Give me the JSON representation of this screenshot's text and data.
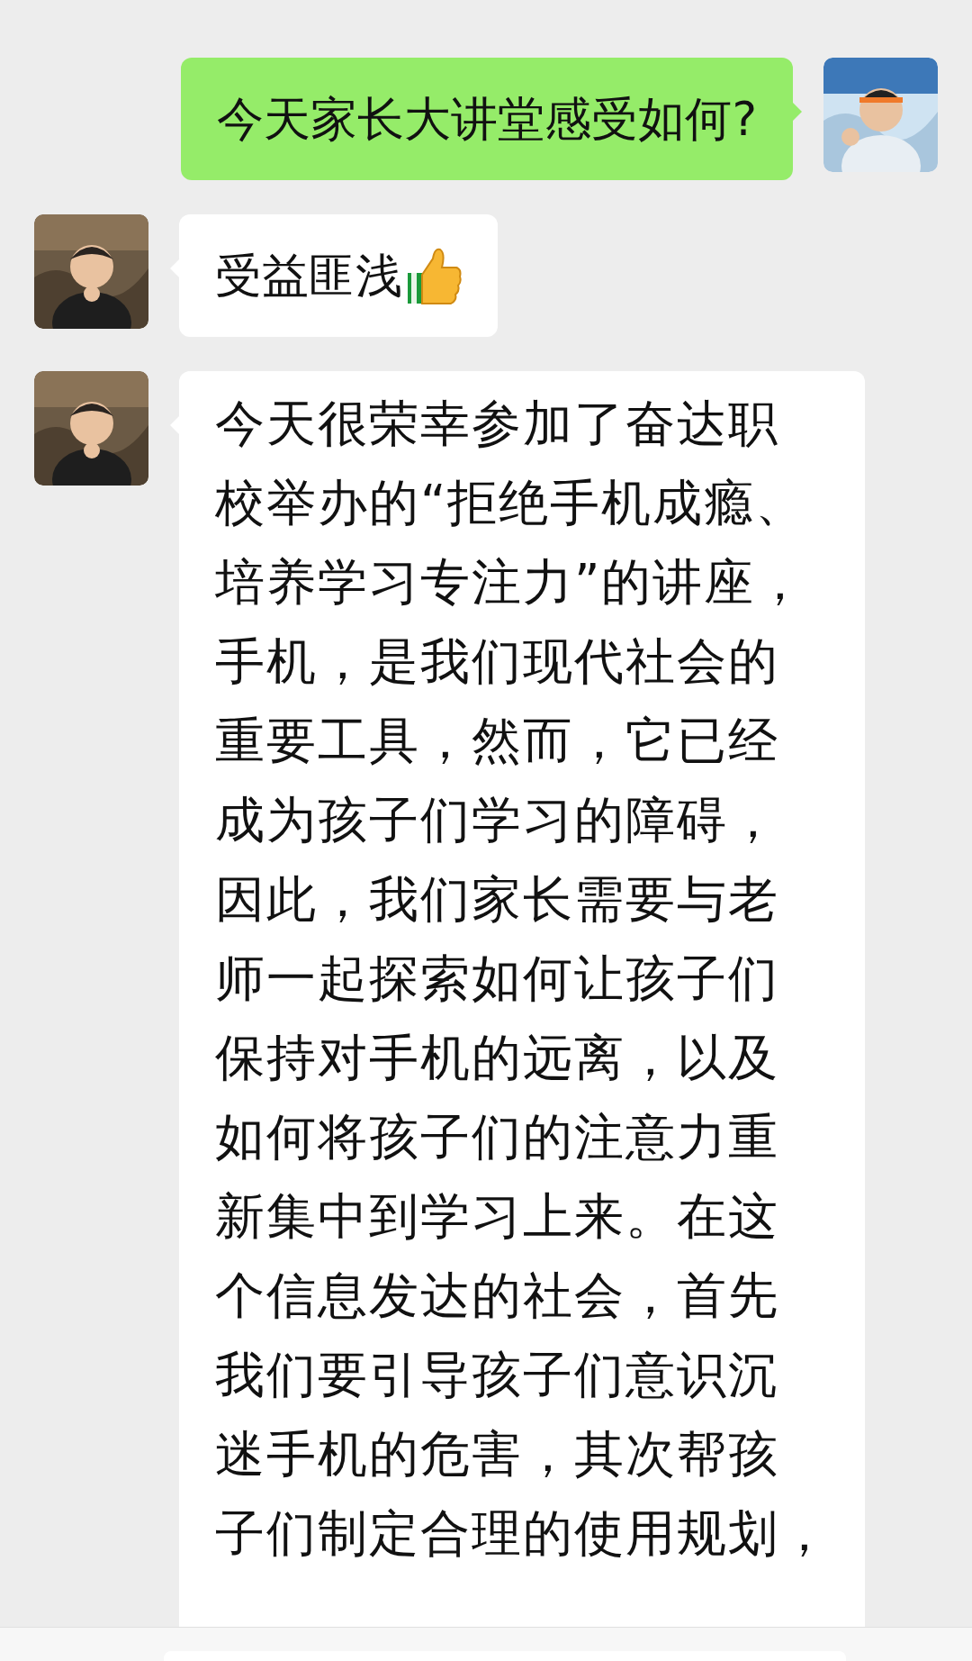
{
  "messages": [
    {
      "outgoing": true,
      "text": "今天家长大讲堂感受如何?"
    },
    {
      "outgoing": false,
      "text": "受益匪浅",
      "thumbs_up": true
    },
    {
      "outgoing": false,
      "lines": [
        "今天很荣幸参加了奋达职",
        "校举办的“拒绝手机成瘾、",
        "培养学习专注力”的讲座，",
        "手机，是我们现代社会的",
        "重要工具，然而，它已经",
        "成为孩子们学习的障碍，",
        "因此，我们家长需要与老",
        "师一起探索如何让孩子们",
        "保持对手机的远离，以及",
        "如何将孩子们的注意力重",
        "新集中到学习上来。在这",
        "个信息发达的社会，首先",
        "我们要引导孩子们意识沉",
        "迷手机的危害，其次帮孩",
        "子们制定合理的使用规划，"
      ]
    }
  ]
}
